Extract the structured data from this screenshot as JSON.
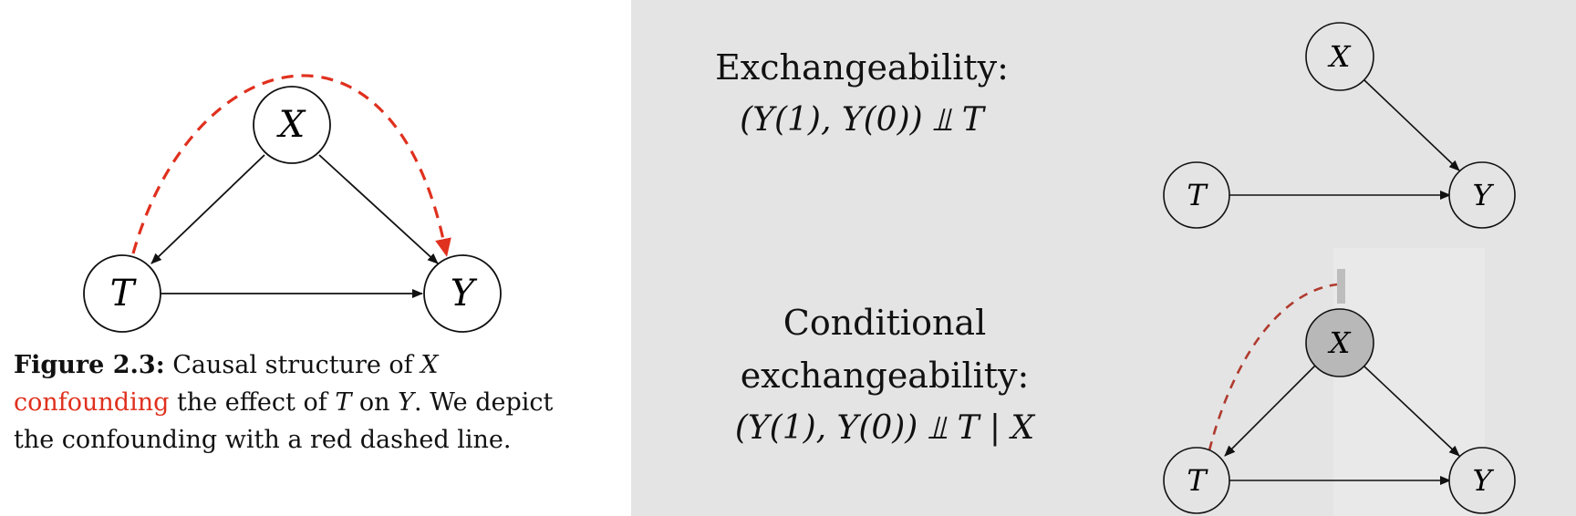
{
  "left_figure": {
    "nodes": {
      "x": "X",
      "t": "T",
      "y": "Y"
    },
    "caption": {
      "label": "Figure 2.3:",
      "text_1": " Causal structure of ",
      "var_x": "X",
      "red_word": "confounding",
      "text_2": " the effect of ",
      "var_t": "T",
      "text_3": " on ",
      "var_y": "Y",
      "text_4": ". We depict the confounding with a red dashed line."
    },
    "colors": {
      "confounding_line": "#e0301e",
      "edge": "#111111"
    }
  },
  "exchangeability": {
    "heading": "Exchangeability:",
    "formula": "(Y(1), Y(0)) ⫫ T",
    "nodes": {
      "x": "X",
      "t": "T",
      "y": "Y"
    }
  },
  "conditional_exchangeability": {
    "heading": "Conditional exchangeability:",
    "formula": "(Y(1), Y(0)) ⫫ T | X",
    "nodes": {
      "x": "X",
      "t": "T",
      "y": "Y"
    },
    "colors": {
      "conditioned_node_fill": "#b8b8b8",
      "dashed_line": "#b03a2e",
      "cut_mark": "#bdbdbd"
    }
  },
  "background_colors": {
    "left": "#ffffff",
    "right": "#e4e4e4"
  }
}
